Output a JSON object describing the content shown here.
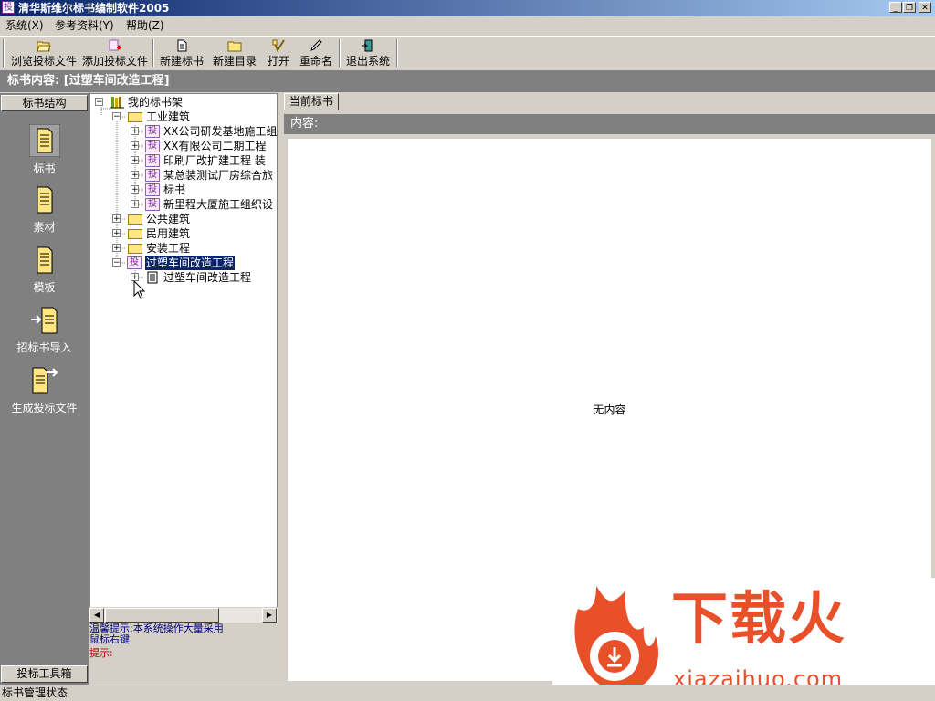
{
  "window": {
    "title": "清华斯维尔标书编制软件2005",
    "app_icon_glyph": "投",
    "min_glyph": "_",
    "restore_glyph": "❐",
    "close_glyph": "✕"
  },
  "menu": [
    "系统(X)",
    "参考资料(Y)",
    "帮助(Z)"
  ],
  "toolbar": [
    {
      "label": "浏览投标文件",
      "icon": "folder-open-icon"
    },
    {
      "label": "添加投标文件",
      "icon": "add-file-icon"
    },
    {
      "label": "新建标书",
      "icon": "new-doc-icon"
    },
    {
      "label": "新建目录",
      "icon": "new-folder-icon"
    },
    {
      "label": "打开",
      "icon": "open-icon"
    },
    {
      "label": "重命名",
      "icon": "rename-pen-icon"
    },
    {
      "label": "退出系统",
      "icon": "exit-door-icon"
    }
  ],
  "content_header": "标书内容: [过塑车间改造工程]",
  "sidebar": {
    "top_button": "标书结构",
    "items": [
      "标书",
      "素材",
      "模板",
      "招标书导入",
      "生成投标文件"
    ],
    "bottom_button": "投标工具箱"
  },
  "tree": {
    "bid_icon_glyph": "投",
    "root": "我的标书架",
    "group1": "工业建筑",
    "group1_children": [
      "XX公司研发基地施工组",
      "XX有限公司二期工程",
      "印刷厂改扩建工程 装",
      "某总装测试厂房综合旅",
      "标书",
      "新里程大厦施工组织设"
    ],
    "other_groups": [
      "公共建筑",
      "民用建筑",
      "安装工程"
    ],
    "selected": "过塑车间改造工程",
    "selected_child": "过塑车间改造工程"
  },
  "tips": {
    "line1": "温馨提示:本系统操作大量采用",
    "line2": "鼠标右键",
    "line3": "提示:"
  },
  "right": {
    "tab": "当前标书",
    "content_label": "内容:",
    "empty": "无内容"
  },
  "status": "标书管理状态",
  "watermark": {
    "brand": "下载火",
    "url": "xiazaihuo.com"
  },
  "colors": {
    "titlebar_start": "#0a246a",
    "titlebar_end": "#a6caf0",
    "panel_gray": "#808080",
    "face": "#d4d0c8",
    "tip_blue": "#000080",
    "tip_red": "#c00000",
    "watermark_orange": "#e8502a"
  }
}
